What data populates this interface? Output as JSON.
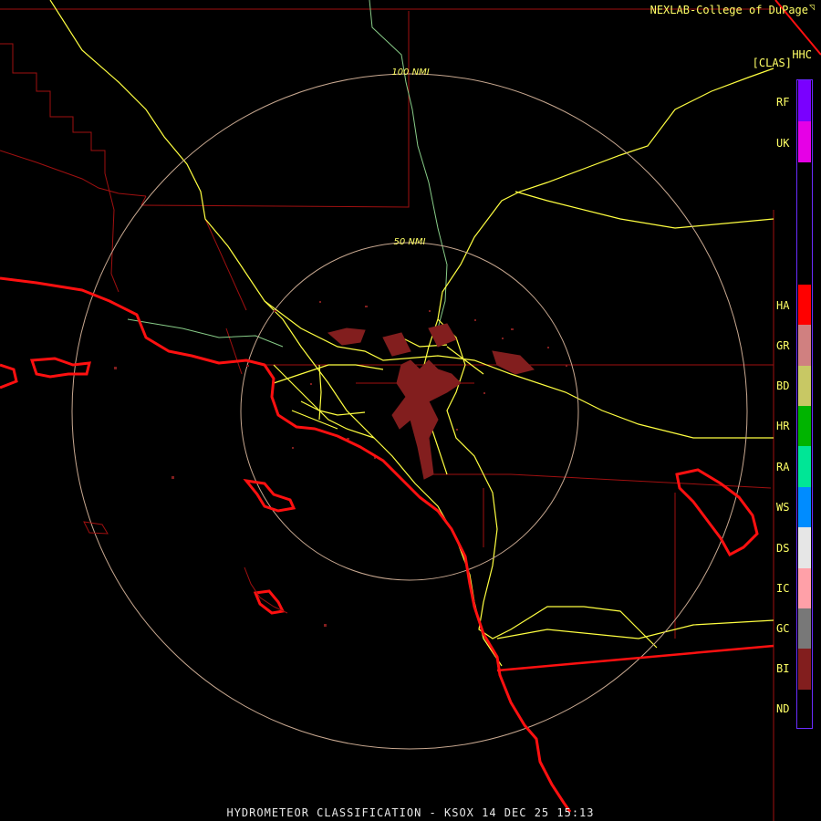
{
  "header": {
    "credit": "NEXLAB-College of DuPage",
    "product_code": "HHC",
    "mode": "[CLAS]"
  },
  "footer": {
    "caption": "HYDROMETEOR CLASSIFICATION - KSOX 14 DEC 25 15:13"
  },
  "range_rings": [
    {
      "label": "100 NMI"
    },
    {
      "label": "50 NMI"
    }
  ],
  "legend": [
    {
      "code": "RF",
      "color": "#7a00ff"
    },
    {
      "code": "UK",
      "color": "#e600e6"
    },
    {
      "code": "HA",
      "color": "#ff0000"
    },
    {
      "code": "GR",
      "color": "#d08080"
    },
    {
      "code": "BD",
      "color": "#c8c864"
    },
    {
      "code": "HR",
      "color": "#00b400"
    },
    {
      "code": "RA",
      "color": "#00e696"
    },
    {
      "code": "WS",
      "color": "#008cff"
    },
    {
      "code": "DS",
      "color": "#e6e6e6"
    },
    {
      "code": "IC",
      "color": "#ffa0a8"
    },
    {
      "code": "GC",
      "color": "#787878"
    },
    {
      "code": "BI",
      "color": "#821e1e"
    },
    {
      "code": "ND",
      "color": "#000000"
    }
  ],
  "colors": {
    "background": "#000000",
    "state_lines": "#a01010",
    "coastline": "#ff1010",
    "highways": "#ffff40",
    "rivers": "#88cc88",
    "range_rings": "#c8a890",
    "echo": "#821e1e"
  }
}
